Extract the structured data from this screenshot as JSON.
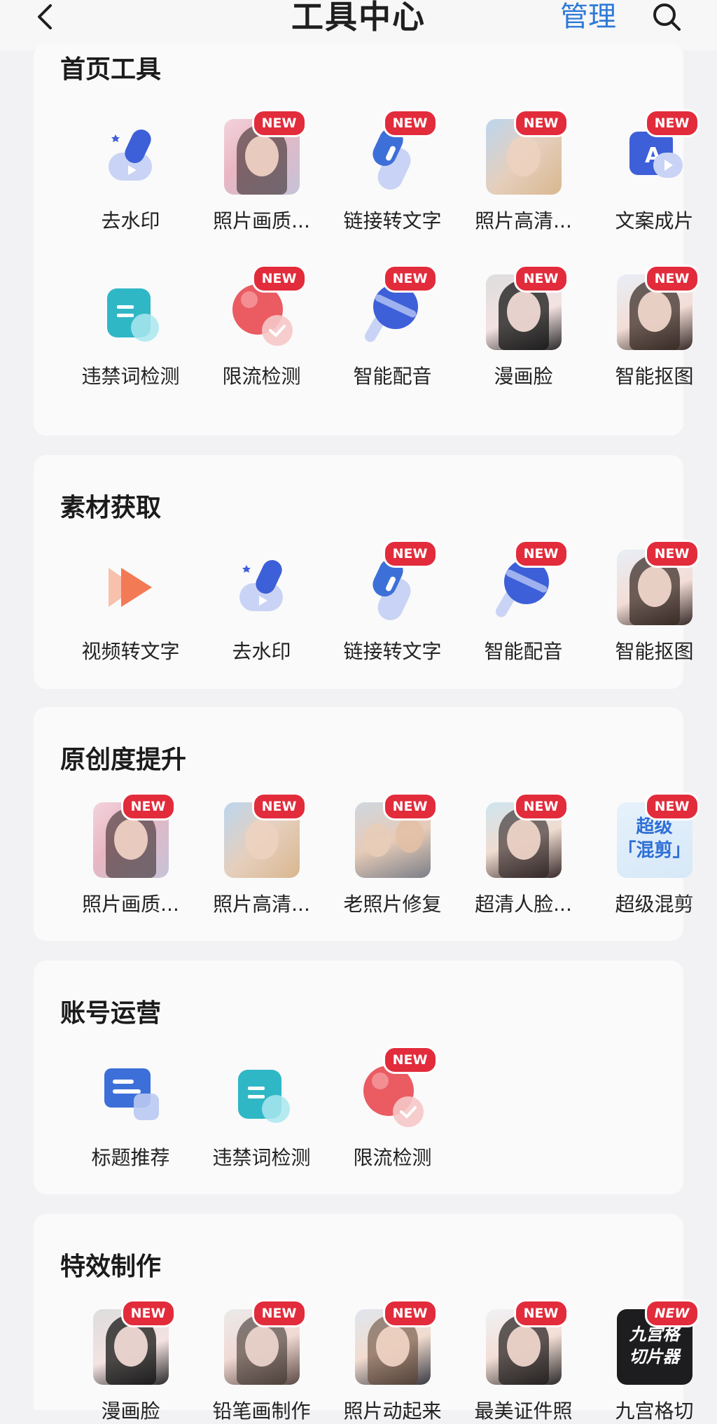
{
  "header": {
    "title": "工具中心",
    "manage_label": "管理",
    "back_icon": "chevron-left-icon",
    "search_icon": "search-icon"
  },
  "badge_text": "NEW",
  "colors": {
    "accent": "#2f7ad6",
    "badge": "#e22b3b"
  },
  "sections": {
    "home": {
      "title": "首页工具",
      "items": [
        {
          "label": "去水印",
          "icon": "watermark-remove-icon"
        },
        {
          "label": "照片画质...",
          "icon": "photo-quality-image"
        },
        {
          "label": "链接转文字",
          "icon": "link-to-text-icon"
        },
        {
          "label": "照片高清...",
          "icon": "photo-hd-image"
        },
        {
          "label": "文案成片",
          "icon": "copy-to-video-icon"
        },
        {
          "label": "违禁词检测",
          "icon": "banned-words-icon"
        },
        {
          "label": "限流检测",
          "icon": "throttle-check-icon"
        },
        {
          "label": "智能配音",
          "icon": "smart-dubbing-icon"
        },
        {
          "label": "漫画脸",
          "icon": "comic-face-image"
        },
        {
          "label": "智能抠图",
          "icon": "smart-cutout-image"
        }
      ]
    },
    "material": {
      "title": "素材获取",
      "items": [
        {
          "label": "视频转文字",
          "icon": "video-to-text-icon"
        },
        {
          "label": "去水印",
          "icon": "watermark-remove-icon"
        },
        {
          "label": "链接转文字",
          "icon": "link-to-text-icon"
        },
        {
          "label": "智能配音",
          "icon": "smart-dubbing-icon"
        },
        {
          "label": "智能抠图",
          "icon": "smart-cutout-image"
        }
      ]
    },
    "original": {
      "title": "原创度提升",
      "items": [
        {
          "label": "照片画质...",
          "icon": "photo-quality-image"
        },
        {
          "label": "照片高清...",
          "icon": "photo-hd-image"
        },
        {
          "label": "老照片修复",
          "icon": "old-photo-restore-image"
        },
        {
          "label": "超清人脸...",
          "icon": "hd-face-image"
        },
        {
          "label": "超级混剪",
          "icon": "super-mix-icon",
          "icon_text": "超级\n「混剪」"
        }
      ]
    },
    "account": {
      "title": "账号运营",
      "items": [
        {
          "label": "标题推荐",
          "icon": "title-recommend-icon"
        },
        {
          "label": "违禁词检测",
          "icon": "banned-words-icon"
        },
        {
          "label": "限流检测",
          "icon": "throttle-check-icon"
        }
      ]
    },
    "effects": {
      "title": "特效制作",
      "items": [
        {
          "label": "漫画脸",
          "icon": "comic-face-image"
        },
        {
          "label": "铅笔画制作",
          "icon": "pencil-sketch-image"
        },
        {
          "label": "照片动起来",
          "icon": "animate-photo-image"
        },
        {
          "label": "最美证件照",
          "icon": "id-photo-image"
        },
        {
          "label": "九宫格切",
          "icon": "nine-grid-icon",
          "icon_text": "九宫格\n切片器"
        }
      ]
    }
  }
}
